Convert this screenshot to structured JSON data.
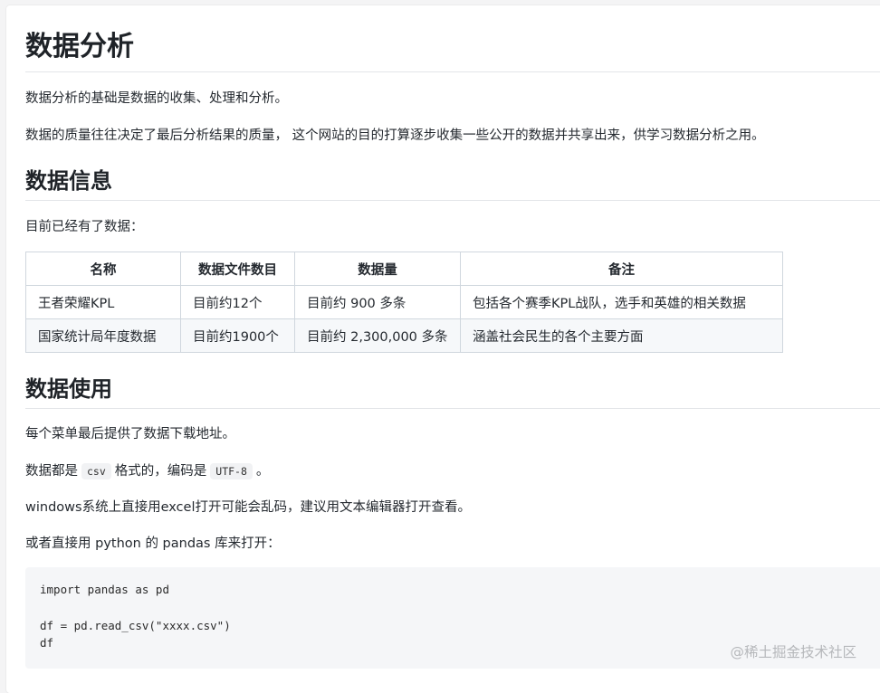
{
  "title": "数据分析",
  "intro": {
    "p1": "数据分析的基础是数据的收集、处理和分析。",
    "p2": "数据的质量往往决定了最后分析结果的质量， 这个网站的目的打算逐步收集一些公开的数据并共享出来，供学习数据分析之用。"
  },
  "info_section": {
    "heading": "数据信息",
    "lead": "目前已经有了数据：",
    "table": {
      "headers": [
        "名称",
        "数据文件数目",
        "数据量",
        "备注"
      ],
      "rows": [
        [
          "王者荣耀KPL",
          "目前约12个",
          "目前约 900 多条",
          "包括各个赛季KPL战队，选手和英雄的相关数据"
        ],
        [
          "国家统计局年度数据",
          "目前约1900个",
          "目前约 2,300,000 多条",
          "涵盖社会民生的各个主要方面"
        ]
      ]
    }
  },
  "usage_section": {
    "heading": "数据使用",
    "p1": "每个菜单最后提供了数据下载地址。",
    "p2_before": "数据都是",
    "p2_code1": "csv",
    "p2_mid": "格式的，编码是",
    "p2_code2": "UTF-8",
    "p2_after": "。",
    "p3": "windows系统上直接用excel打开可能会乱码，建议用文本编辑器打开查看。",
    "p4": "或者直接用 python 的 pandas 库来打开：",
    "code": {
      "line1": "import pandas as pd",
      "line2": "df = pd.read_csv(\"xxxx.csv\")",
      "line3": "df"
    }
  },
  "watermark": "@稀土掘金技术社区"
}
